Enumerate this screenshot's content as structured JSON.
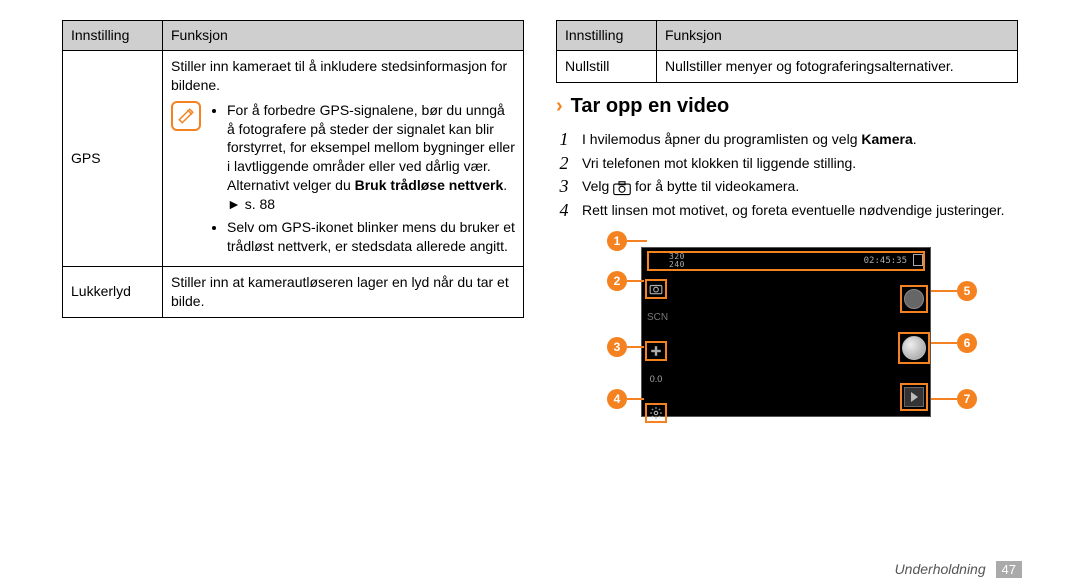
{
  "left_table": {
    "headers": {
      "setting": "Innstilling",
      "function": "Funksjon"
    },
    "rows": [
      {
        "label": "GPS",
        "intro": "Stiller inn kameraet til å inkludere stedsinformasjon for bildene.",
        "note_icon": "pencil-note-icon",
        "bullets": {
          "b1_pre": "For å forbedre GPS-signalene, bør du unngå å fotografere på steder der signalet kan blir forstyrret, for eksempel mellom bygninger eller i lavtliggende områder eller ved dårlig vær. Alternativt velger du ",
          "b1_bold": "Bruk trådløse nettverk",
          "b1_post": ". ► s. 88",
          "b2": "Selv om GPS-ikonet blinker mens du bruker et trådløst nettverk, er stedsdata allerede angitt."
        }
      },
      {
        "label": "Lukkerlyd",
        "text": "Stiller inn at kamerautløseren lager en lyd når du tar et bilde."
      }
    ]
  },
  "right_table": {
    "headers": {
      "setting": "Innstilling",
      "function": "Funksjon"
    },
    "rows": [
      {
        "label": "Nullstill",
        "text": "Nullstiller menyer og fotograferingsalternativer."
      }
    ]
  },
  "section": {
    "chevron": "›",
    "title": "Tar opp en video"
  },
  "steps": [
    {
      "n": "1",
      "pre": "I hvilemodus åpner du programlisten og velg ",
      "bold": "Kamera",
      "post": "."
    },
    {
      "n": "2",
      "text": "Vri telefonen mot klokken til liggende stilling."
    },
    {
      "n": "3",
      "pre": "Velg ",
      "icon": "camera-switch-icon",
      "post": " for å bytte til videokamera."
    },
    {
      "n": "4",
      "text": "Rett linsen mot motivet, og foreta eventuelle nødvendige justeringer."
    }
  ],
  "camera": {
    "res_top": "320",
    "res_bot": "240",
    "timer": "02:45:35",
    "left_labels": {
      "scn": "SCN",
      "ev": "0.0"
    },
    "callouts": {
      "c1": "1",
      "c2": "2",
      "c3": "3",
      "c4": "4",
      "c5": "5",
      "c6": "6",
      "c7": "7"
    }
  },
  "footer": {
    "section": "Underholdning",
    "page": "47"
  }
}
